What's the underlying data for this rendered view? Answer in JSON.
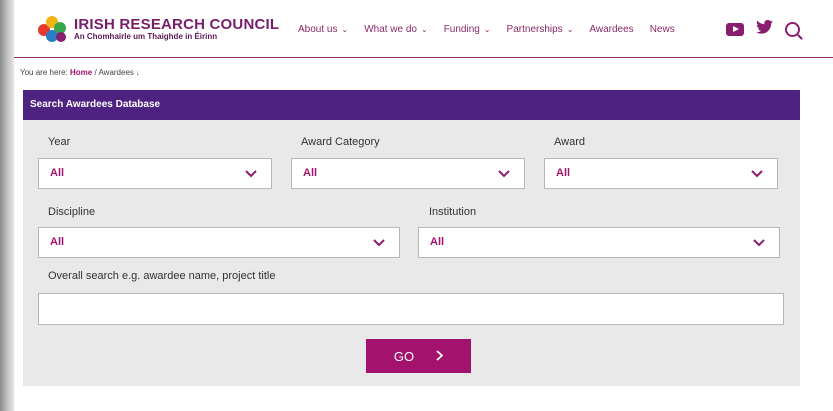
{
  "brand": {
    "name": "IRISH RESEARCH COUNCIL",
    "sub": "An Chomhairle um Thaighde in Éirinn"
  },
  "nav": {
    "items": [
      {
        "label": "About us",
        "dropdown": true
      },
      {
        "label": "What we do",
        "dropdown": true
      },
      {
        "label": "Funding",
        "dropdown": true
      },
      {
        "label": "Partnerships",
        "dropdown": true
      },
      {
        "label": "Awardees",
        "dropdown": false
      },
      {
        "label": "News",
        "dropdown": false
      }
    ]
  },
  "social": {
    "icons": [
      "youtube-icon",
      "twitter-icon",
      "search-icon"
    ]
  },
  "breadcrumb": {
    "prefix": "You are here:",
    "home": "Home",
    "separator": "/",
    "current": "Awardees"
  },
  "search": {
    "heading": "Search Awardees Database",
    "year": {
      "label": "Year",
      "value": "All"
    },
    "award_category": {
      "label": "Award Category",
      "value": "All"
    },
    "award": {
      "label": "Award",
      "value": "All"
    },
    "discipline": {
      "label": "Discipline",
      "value": "All"
    },
    "institution": {
      "label": "Institution",
      "value": "All"
    },
    "overall": {
      "label": "Overall search e.g. awardee name, project title",
      "value": ""
    },
    "go_label": "GO"
  },
  "colors": {
    "brand_purple": "#4e2280",
    "accent_magenta": "#a3136e",
    "panel_grey": "#e9e9e9"
  }
}
